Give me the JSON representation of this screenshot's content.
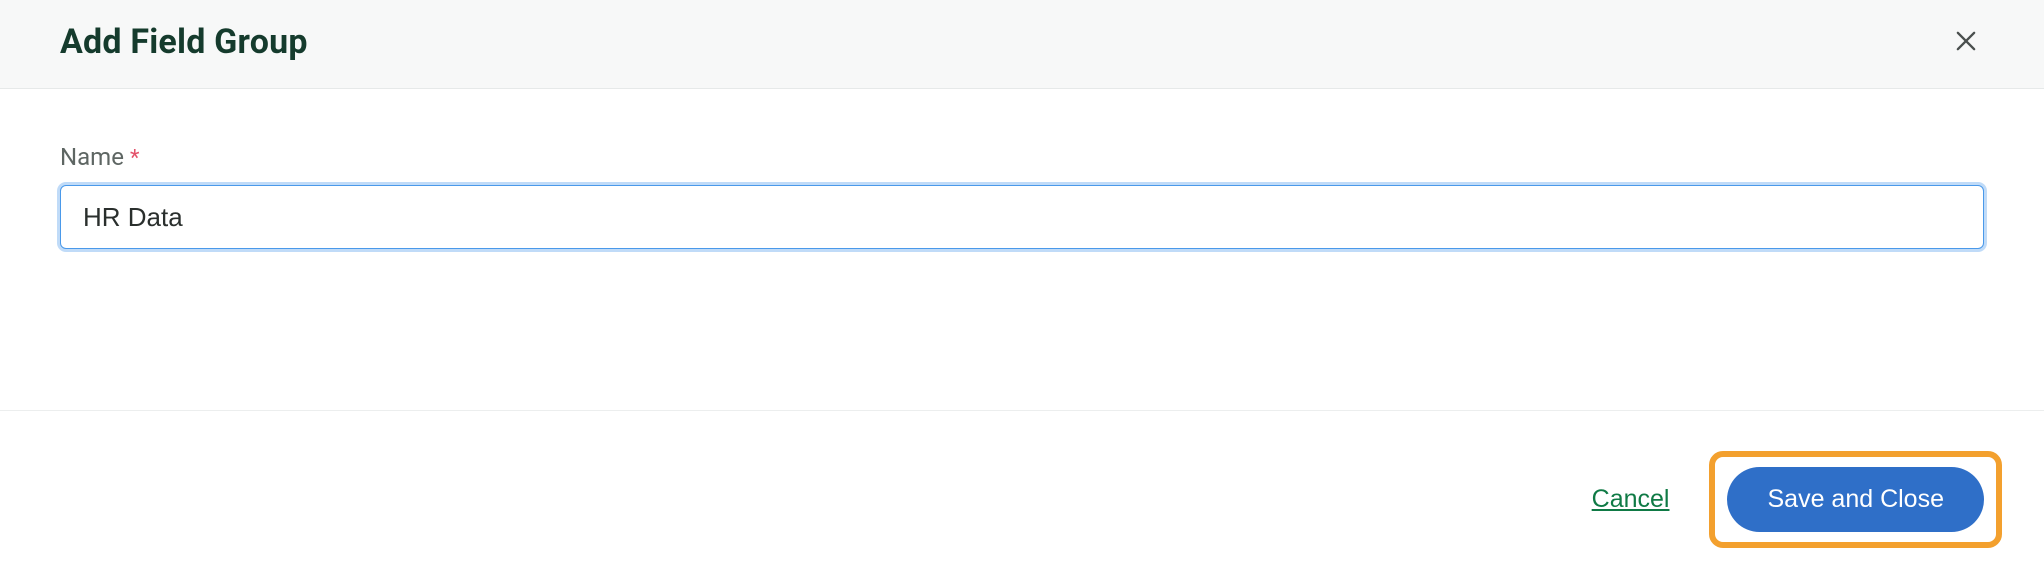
{
  "header": {
    "title": "Add Field Group",
    "close_icon_name": "close-icon"
  },
  "form": {
    "name_field": {
      "label": "Name",
      "required_marker": "*",
      "value": "HR Data",
      "placeholder": ""
    }
  },
  "footer": {
    "cancel_label": "Cancel",
    "save_label": "Save and Close"
  }
}
